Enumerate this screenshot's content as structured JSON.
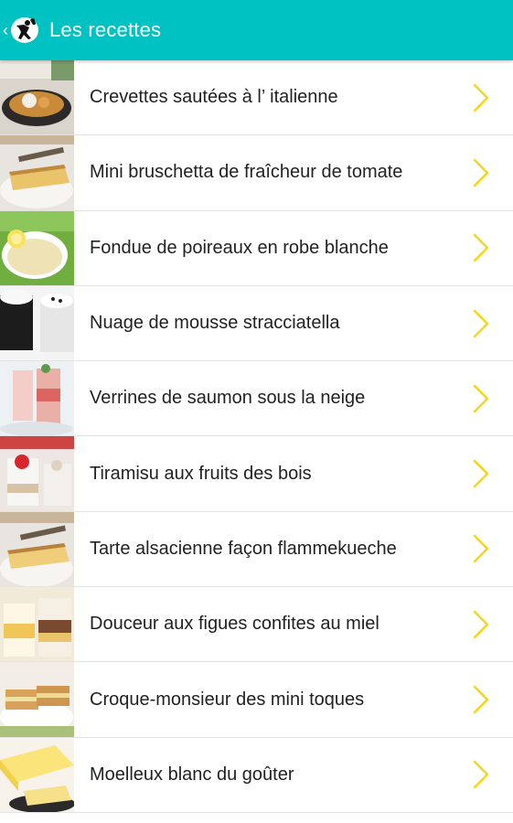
{
  "appbar": {
    "title": "Les recettes",
    "background": "#00c2c3",
    "back_icon": "chevron-left-icon",
    "logo_icon": "chef-logo-icon"
  },
  "accent": {
    "chevron_color": "#f5d520"
  },
  "recipes": [
    {
      "title": "Crevettes sautées à l’ italienne",
      "thumb": "shrimp-dish-thumbnail"
    },
    {
      "title": "Mini bruschetta de fraîcheur de tomate",
      "thumb": "bruschetta-thumbnail"
    },
    {
      "title": "Fondue de poireaux en robe blanche",
      "thumb": "leek-fondue-thumbnail"
    },
    {
      "title": "Nuage de mousse stracciatella",
      "thumb": "mousse-thumbnail"
    },
    {
      "title": "Verrines de saumon sous la neige",
      "thumb": "salmon-verrine-thumbnail"
    },
    {
      "title": "Tiramisu aux fruits des bois",
      "thumb": "tiramisu-thumbnail"
    },
    {
      "title": "Tarte alsacienne façon flammekueche",
      "thumb": "flammekueche-thumbnail"
    },
    {
      "title": "Douceur aux figues confites au miel",
      "thumb": "fig-dessert-thumbnail"
    },
    {
      "title": "Croque-monsieur des mini toques",
      "thumb": "croque-monsieur-thumbnail"
    },
    {
      "title": "Moelleux blanc du goûter",
      "thumb": "white-cake-thumbnail"
    }
  ]
}
